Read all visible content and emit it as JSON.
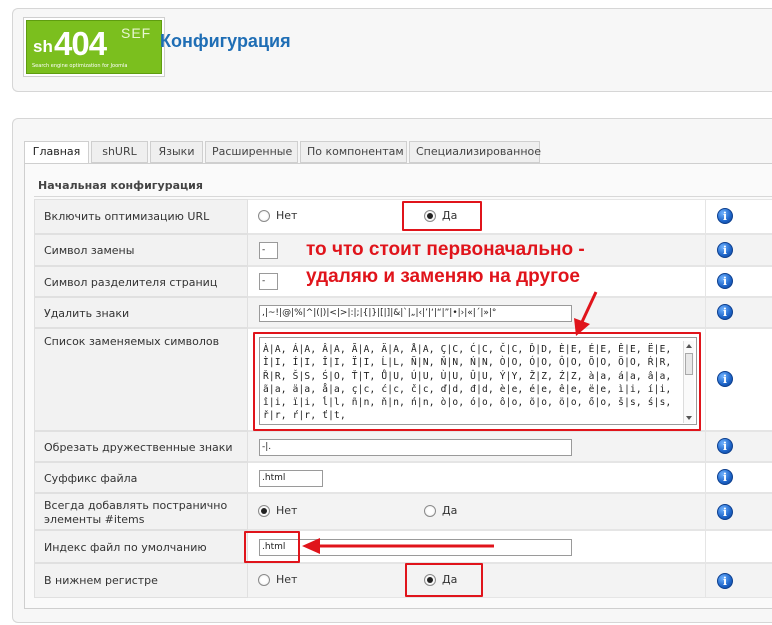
{
  "header": {
    "logo_main": "404",
    "logo_prefix": "sh",
    "logo_suffix": "SEF",
    "logo_tagline": "Search engine optimization for Joomla",
    "title": "Конфигурация"
  },
  "tabs": [
    {
      "label": "Главная",
      "active": true
    },
    {
      "label": "shURL",
      "active": false
    },
    {
      "label": "Языки",
      "active": false
    },
    {
      "label": "Расширенные",
      "active": false
    },
    {
      "label": "По компонентам",
      "active": false
    },
    {
      "label": "Специализированное",
      "active": false
    }
  ],
  "section": {
    "title": "Начальная конфигурация"
  },
  "radio_labels": {
    "no": "Нет",
    "yes": "Да"
  },
  "settings": {
    "enable_url": {
      "label": "Включить оптимизацию URL",
      "selected": "Да"
    },
    "replacement_char": {
      "label": "Символ замены",
      "value": "-"
    },
    "page_separator": {
      "label": "Символ разделителя страниц",
      "value": "-"
    },
    "strip_chars": {
      "label": "Удалить знаки",
      "value": ",|~!|@|%|^|(|)|<|>|:|;|{|}|[|]|&|`|„|‹|’|‘|“|”|•|›|«|´|»|°"
    },
    "replace_list": {
      "label": "Список заменяемых символов",
      "value": "À|A, Á|A, Â|A, Ã|A, Ä|A, Å|A, Ç|C, Ć|C, Č|C, Ď|D, È|E, É|E, Ê|E, Ë|E, Ì|I, Í|I, Î|I, Ï|I, Ĺ|L, Ñ|N, Ň|N, Ń|N, Ò|O, Ó|O, Ô|O, Õ|O, Ö|O, Ŕ|R, Ř|R, Š|S, Ś|O, Ť|T, Ů|U, Ú|U, Ù|U, Û|U, Ý|Y, Ž|Z, Ź|Z, à|a, á|a, â|a, ã|a, ä|a, å|a, ç|c, ć|c, č|c, ď|d, đ|d, è|e, é|e, ê|e, ë|e, ì|i, í|i, î|i, ï|i, ĺ|l, ñ|n, ň|n, ń|n, ò|o, ó|o, ô|o, õ|o, ö|o, ő|o, š|s, ś|s, ř|r, ŕ|r, ť|t,"
    },
    "friendly_trim": {
      "label": "Обрезать дружественные знаки",
      "value": "-|."
    },
    "file_suffix": {
      "label": "Суффикс файла",
      "value": ".html"
    },
    "add_items": {
      "label": "Всегда добавлять постранично элементы #items",
      "selected": "Нет"
    },
    "default_index": {
      "label": "Индекс файл по умолчанию",
      "value": ".html"
    },
    "lowercase": {
      "label": "В нижнем регистре",
      "selected": "Да"
    }
  },
  "info_icon_glyph": "i",
  "annotation": {
    "line1": "то что стоит первоначально -",
    "line2": "удаляю и заменяю на другое",
    "color": "#e0141b"
  }
}
